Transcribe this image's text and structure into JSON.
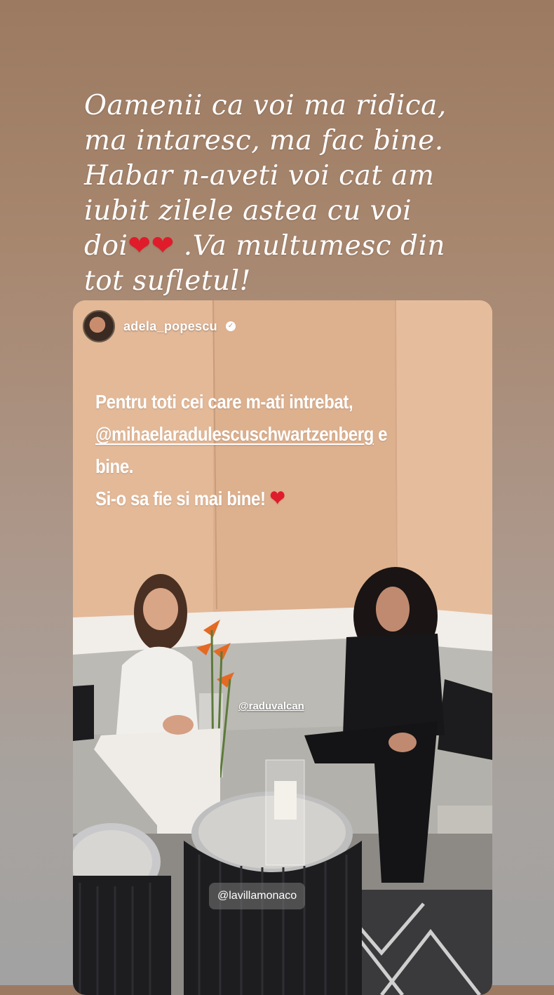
{
  "story": {
    "caption_lines": [
      "Oamenii ca voi ma ridica,",
      "ma intaresc, ma fac bine.",
      "Habar n-aveti voi cat am",
      "iubit zilele astea cu voi",
      "doi",
      ".Va multumesc din",
      "tot sufletul!"
    ],
    "caption_hearts": "❤❤"
  },
  "post": {
    "username": "adela_popescu",
    "verified_glyph": "✓",
    "text_line1": "Pentru toti cei care m-ati intrebat,",
    "text_mention": "@mihaelaradulescuschwartzenberg",
    "text_line2_suffix": " e bine.",
    "text_line3": "Si-o sa fie si mai bine! ",
    "text_heart": "❤",
    "tag_person": "@raduvalcan",
    "tag_location": "@lavillamonaco"
  },
  "colors": {
    "wall": "#e2b796",
    "heart": "#e01b2a",
    "sofa": "#bdbbb6"
  }
}
